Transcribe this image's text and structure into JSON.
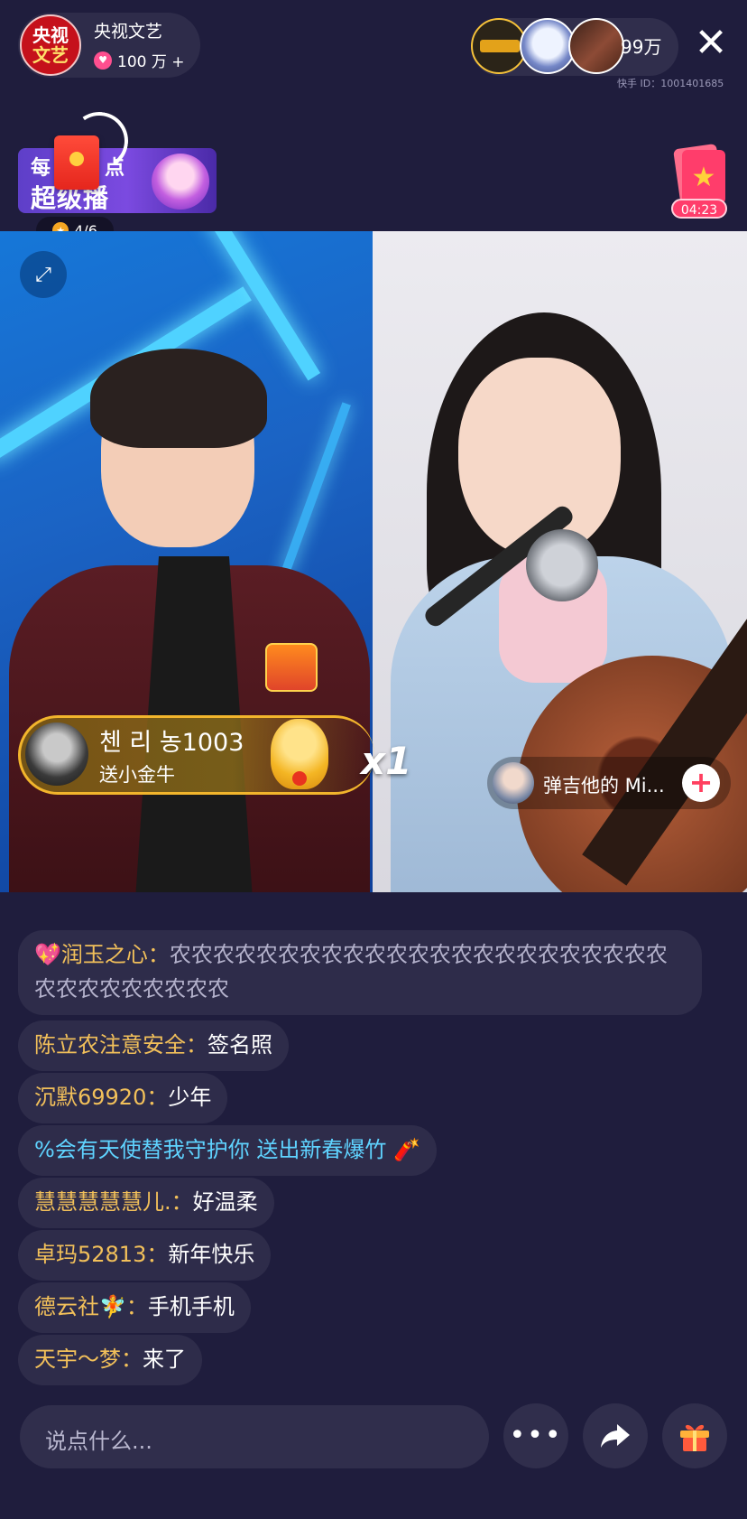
{
  "header": {
    "host_avatar_line1": "央视",
    "host_avatar_line2": "文艺",
    "host_name": "央视文艺",
    "likes": "100 万 +",
    "viewer_count": "99万",
    "close_label": "✕",
    "kuaishou_id": "快手 ID：1001401685"
  },
  "banner": {
    "top_text": "每",
    "top_text_suffix": "点",
    "main_text": "超级播",
    "progress": "4/6"
  },
  "timer": {
    "label": "04:23"
  },
  "gift_notice": {
    "user": "첸 리 농1003",
    "desc": "送小金牛",
    "count": "x1"
  },
  "cohost": {
    "name": "弹吉他的 Mi...",
    "add_label": "+"
  },
  "chat": [
    {
      "nick": "💖润玉之心：",
      "msg": "农农农农农农农农农农农农农农农农农农农农农农农农农农农农农农农农",
      "style": "muted"
    },
    {
      "nick": "陈立农注意安全：",
      "msg": "签名照",
      "style": "normal"
    },
    {
      "nick": "沉默69920：",
      "msg": "少年",
      "style": "normal"
    },
    {
      "nick": "%会有天使替我守护你 送出新春爆竹 🧨",
      "msg": "",
      "style": "cyan"
    },
    {
      "nick": "慧慧慧慧慧儿.：",
      "msg": "好温柔",
      "style": "normal"
    },
    {
      "nick": "卓玛52813：",
      "msg": "新年快乐",
      "style": "normal"
    },
    {
      "nick": "德云社🧚：",
      "msg": "手机手机",
      "style": "normal"
    },
    {
      "nick": "天宇～梦：",
      "msg": "来了",
      "style": "normal"
    }
  ],
  "input": {
    "placeholder": "说点什么..."
  },
  "icons": {
    "more": "more-icon",
    "share": "share-icon",
    "gift": "gift-icon",
    "expand": "expand-icon",
    "close": "close-icon"
  },
  "colors": {
    "background": "#1f1d3d",
    "nickname": "#f2c05a",
    "system_message": "#5fd3ff",
    "gift_border": "#f2b52c",
    "add_button_plus": "#ff3f5f"
  }
}
